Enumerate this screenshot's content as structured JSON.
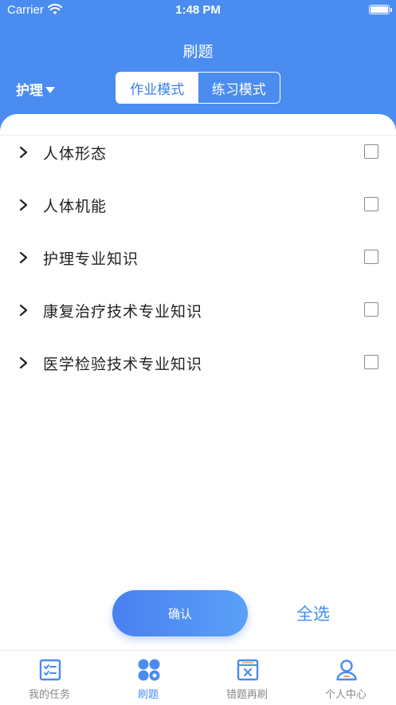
{
  "status_bar": {
    "carrier": "Carrier",
    "time": "1:48 PM"
  },
  "nav": {
    "title": "刷题"
  },
  "subject_selector": {
    "label": "护理"
  },
  "mode_switch": {
    "options": [
      "作业模式",
      "练习模式"
    ],
    "selected": "作业模式"
  },
  "categories": [
    {
      "label": "人体形态",
      "checked": false
    },
    {
      "label": "人体机能",
      "checked": false
    },
    {
      "label": "护理专业知识",
      "checked": false
    },
    {
      "label": "康复治疗技术专业知识",
      "checked": false
    },
    {
      "label": "医学检验技术专业知识",
      "checked": false
    }
  ],
  "actions": {
    "confirm": "确认",
    "select_all": "全选"
  },
  "tabbar": {
    "items": [
      {
        "label": "我的任务",
        "icon": "task-list-icon"
      },
      {
        "label": "刷题",
        "icon": "practice-grid-icon"
      },
      {
        "label": "错题再刷",
        "icon": "wrong-questions-icon"
      },
      {
        "label": "个人中心",
        "icon": "profile-icon"
      }
    ],
    "active": "刷题"
  },
  "colors": {
    "primary": "#4a8cf0",
    "accent_text": "#3a8ff0",
    "inactive_tab": "#888888"
  }
}
